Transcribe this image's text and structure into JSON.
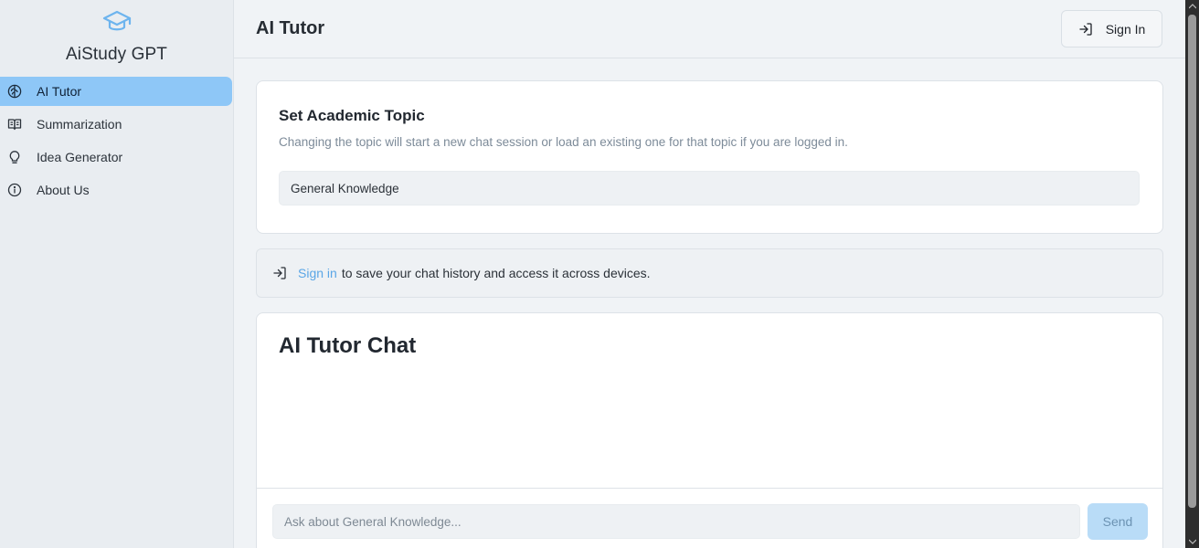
{
  "sidebar": {
    "brand_name": "AiStudy GPT",
    "logo_icon": "graduation-cap-icon",
    "items": [
      {
        "label": "AI Tutor",
        "icon": "brain-icon",
        "active": true
      },
      {
        "label": "Summarization",
        "icon": "book-open-icon",
        "active": false
      },
      {
        "label": "Idea Generator",
        "icon": "lightbulb-icon",
        "active": false
      },
      {
        "label": "About Us",
        "icon": "info-icon",
        "active": false
      }
    ]
  },
  "header": {
    "title": "AI Tutor",
    "sign_in_label": "Sign In",
    "sign_in_icon": "log-in-icon"
  },
  "topic_card": {
    "title": "Set Academic Topic",
    "description": "Changing the topic will start a new chat session or load an existing one for that topic if you are logged in.",
    "topic_value": "General Knowledge"
  },
  "notice": {
    "icon": "log-in-icon",
    "link_text": "Sign in",
    "text": "to save your chat history and access it across devices."
  },
  "chat": {
    "title": "AI Tutor Chat",
    "input_placeholder": "Ask about General Knowledge...",
    "send_label": "Send"
  },
  "colors": {
    "accent": "#8ec7f7",
    "link": "#5aa6e6",
    "send_disabled": "#b9dcf7",
    "sidebar_bg": "#e9edf1",
    "page_bg": "#f0f3f6"
  }
}
